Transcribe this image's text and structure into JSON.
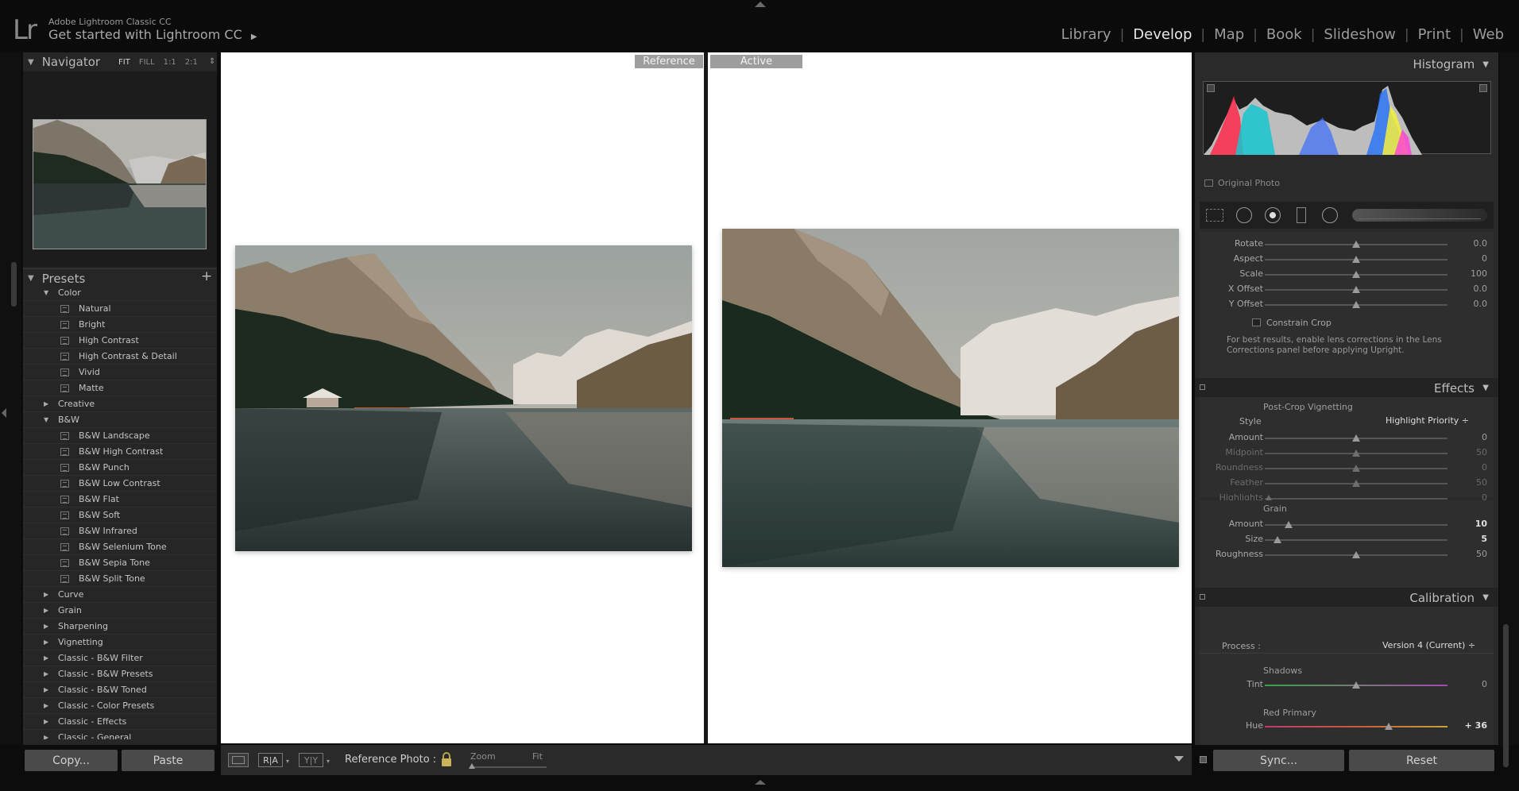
{
  "app": {
    "logo": "Lr",
    "name": "Adobe Lightroom Classic CC",
    "subtitle": "Get started with Lightroom CC",
    "subtitle_arrow": "▶"
  },
  "modules": [
    "Library",
    "Develop",
    "Map",
    "Book",
    "Slideshow",
    "Print",
    "Web"
  ],
  "active_module": "Develop",
  "navigator": {
    "title": "Navigator",
    "zoom_options": [
      "FIT",
      "FILL",
      "1:1",
      "2:1"
    ],
    "active_zoom": "FIT",
    "zoom_stepper": "⇕"
  },
  "presets": {
    "title": "Presets",
    "add_label": "+",
    "rows": [
      {
        "type": "folder",
        "label": "Color",
        "open": true
      },
      {
        "type": "item",
        "label": "Natural"
      },
      {
        "type": "item",
        "label": "Bright"
      },
      {
        "type": "item",
        "label": "High Contrast"
      },
      {
        "type": "item",
        "label": "High Contrast & Detail"
      },
      {
        "type": "item",
        "label": "Vivid"
      },
      {
        "type": "item",
        "label": "Matte"
      },
      {
        "type": "folder",
        "label": "Creative",
        "open": false
      },
      {
        "type": "folder",
        "label": "B&W",
        "open": true
      },
      {
        "type": "item",
        "label": "B&W Landscape"
      },
      {
        "type": "item",
        "label": "B&W High Contrast"
      },
      {
        "type": "item",
        "label": "B&W Punch"
      },
      {
        "type": "item",
        "label": "B&W Low Contrast"
      },
      {
        "type": "item",
        "label": "B&W Flat"
      },
      {
        "type": "item",
        "label": "B&W Soft"
      },
      {
        "type": "item",
        "label": "B&W Infrared"
      },
      {
        "type": "item",
        "label": "B&W Selenium Tone"
      },
      {
        "type": "item",
        "label": "B&W Sepia Tone"
      },
      {
        "type": "item",
        "label": "B&W Split Tone"
      },
      {
        "type": "folder",
        "label": "Curve",
        "open": false
      },
      {
        "type": "folder",
        "label": "Grain",
        "open": false
      },
      {
        "type": "folder",
        "label": "Sharpening",
        "open": false
      },
      {
        "type": "folder",
        "label": "Vignetting",
        "open": false
      },
      {
        "type": "folder",
        "label": "Classic - B&W Filter",
        "open": false
      },
      {
        "type": "folder",
        "label": "Classic - B&W Presets",
        "open": false
      },
      {
        "type": "folder",
        "label": "Classic - B&W Toned",
        "open": false
      },
      {
        "type": "folder",
        "label": "Classic - Color Presets",
        "open": false
      },
      {
        "type": "folder",
        "label": "Classic - Effects",
        "open": false
      },
      {
        "type": "folder",
        "label": "Classic - General",
        "open": false
      }
    ]
  },
  "left_buttons": {
    "copy": "Copy...",
    "paste": "Paste"
  },
  "views": {
    "reference": "Reference",
    "active": "Active"
  },
  "toolbar": {
    "ra_label": "R|A",
    "yy_label": "Y|Y",
    "reference_photo_label": "Reference Photo :",
    "zoom_label": "Zoom",
    "fit_label": "Fit"
  },
  "histogram": {
    "title": "Histogram",
    "original_photo_label": "Original Photo"
  },
  "transform": {
    "sliders": [
      {
        "label": "Rotate",
        "value": "0.0",
        "pos": 0.5
      },
      {
        "label": "Aspect",
        "value": "0",
        "pos": 0.5
      },
      {
        "label": "Scale",
        "value": "100",
        "pos": 0.5
      },
      {
        "label": "X Offset",
        "value": "0.0",
        "pos": 0.5
      },
      {
        "label": "Y Offset",
        "value": "0.0",
        "pos": 0.5
      }
    ],
    "constrain_crop": "Constrain Crop",
    "note": "For best results, enable lens corrections in the Lens Corrections panel before applying Upright."
  },
  "effects": {
    "title": "Effects",
    "vignetting_title": "Post-Crop Vignetting",
    "style_label": "Style",
    "style_value": "Highlight Priority ÷",
    "vignette_sliders": [
      {
        "label": "Amount",
        "value": "0",
        "pos": 0.5,
        "dim": false
      },
      {
        "label": "Midpoint",
        "value": "50",
        "pos": 0.5,
        "dim": true
      },
      {
        "label": "Roundness",
        "value": "0",
        "pos": 0.5,
        "dim": true
      },
      {
        "label": "Feather",
        "value": "50",
        "pos": 0.5,
        "dim": true
      },
      {
        "label": "Highlights",
        "value": "0",
        "pos": 0.02,
        "dim": true
      }
    ],
    "grain_title": "Grain",
    "grain_sliders": [
      {
        "label": "Amount",
        "value": "10",
        "pos": 0.13,
        "bold": true
      },
      {
        "label": "Size",
        "value": "5",
        "pos": 0.07,
        "bold": true
      },
      {
        "label": "Roughness",
        "value": "50",
        "pos": 0.5,
        "bold": false
      }
    ]
  },
  "calibration": {
    "title": "Calibration",
    "process_label": "Process :",
    "process_value": "Version 4 (Current) ÷",
    "shadows_title": "Shadows",
    "tint": {
      "label": "Tint",
      "value": "0",
      "pos": 0.5
    },
    "red_primary_title": "Red Primary",
    "hue": {
      "label": "Hue",
      "value": "+ 36",
      "pos": 0.68
    }
  },
  "right_buttons": {
    "sync": "Sync...",
    "reset": "Reset"
  }
}
